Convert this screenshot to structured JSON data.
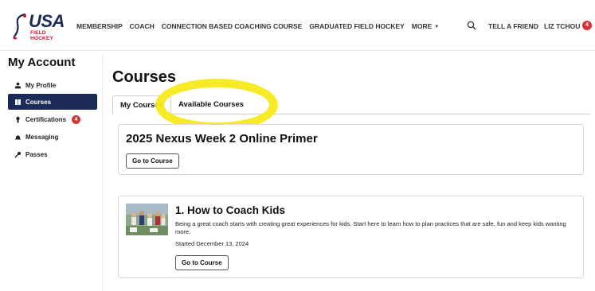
{
  "brand": {
    "logo_text": "USA",
    "logo_sub": "FIELD HOCKEY",
    "accent_color": "#1b2a57",
    "red_color": "#c8102e"
  },
  "header": {
    "nav": [
      "MEMBERSHIP",
      "COACH",
      "CONNECTION BASED COACHING COURSE",
      "GRADUATED FIELD HOCKEY",
      "MORE"
    ],
    "tell_friend": "TELL A FRIEND",
    "user_name": "LIZ TCHOU",
    "user_badge": "4"
  },
  "sidebar": {
    "title": "My Account",
    "items": [
      {
        "label": "My Profile",
        "icon": "person-icon",
        "active": false
      },
      {
        "label": "Courses",
        "icon": "book-icon",
        "active": true
      },
      {
        "label": "Certifications",
        "icon": "award-icon",
        "active": false,
        "badge": "4"
      },
      {
        "label": "Messaging",
        "icon": "bell-icon",
        "active": false
      },
      {
        "label": "Passes",
        "icon": "key-icon",
        "active": false
      }
    ]
  },
  "main": {
    "title": "Courses",
    "tabs": [
      {
        "label": "My Courses",
        "active": true
      },
      {
        "label": "Available Courses",
        "active": false
      }
    ],
    "courses": [
      {
        "title": "2025 Nexus Week 2 Online Primer",
        "button": "Go to Course"
      },
      {
        "title": "1. How to Coach Kids",
        "description": "Being a great coach starts with creating great experiences for kids. Start here to learn how to plan practices that are safe, fun and keep kids wanting more.",
        "started": "Started December 13, 2024",
        "button": "Go to Course"
      }
    ]
  }
}
